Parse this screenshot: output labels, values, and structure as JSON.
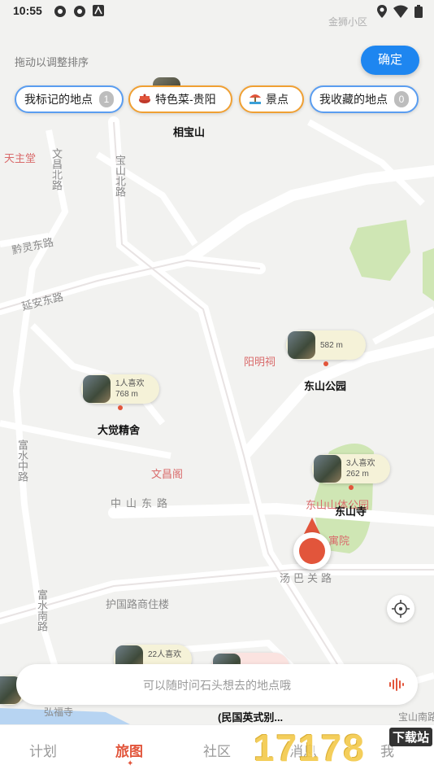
{
  "status_bar": {
    "time": "10:55"
  },
  "header": {
    "hint": "拖动以调整排序",
    "confirm_label": "确定"
  },
  "chips": [
    {
      "label": "我标记的地点",
      "count": "1"
    },
    {
      "label": "特色菜-贵阳",
      "icon": "dish-icon"
    },
    {
      "label": "景点",
      "icon": "attraction-icon"
    },
    {
      "label": "我收藏的地点",
      "count": "0"
    }
  ],
  "markers": {
    "dongshan_park": {
      "distance": "582 m",
      "name": "东山公园"
    },
    "dajue": {
      "likes": "1人喜欢",
      "distance": "768 m",
      "name": "大觉精舍"
    },
    "dongshan_temple": {
      "likes": "3人喜欢",
      "distance": "262 m",
      "name": "东山寺"
    },
    "bottom_left": {
      "likes": "22人喜欢"
    },
    "bottom_mid": {
      "name": "(民国英式别..."
    },
    "top": {
      "name": "相宝山"
    }
  },
  "map_labels": {
    "tianzhutang": "天主堂",
    "baoshan_north": "宝山北路",
    "yangming": "阳明祠",
    "qianling_east": "黔灵东路",
    "yan_an_east": "延安东路",
    "wenchang_pavilion": "文昌阁",
    "zhongshan_east": "中山东路",
    "tangba": "汤巴关路",
    "huguo": "护国路商住楼",
    "dongshan_sports_park": "东山山体公园",
    "fushui_south": "富水南路",
    "fushui_middle": "富水中路",
    "hongfu": "弘福寺",
    "top_district": "金狮小区",
    "wenchang_north": "文昌北路",
    "baoshan_south": "宝山南路",
    "yuyuan": "寓院"
  },
  "search": {
    "placeholder": "可以随时问石头想去的地点哦"
  },
  "nav": {
    "tabs": [
      "计划",
      "旅图",
      "社区",
      "消息",
      "我"
    ],
    "active_index": 1
  },
  "watermark": {
    "text": "17178",
    "sub": "下载站"
  },
  "colors": {
    "accent_blue": "#1e86f0",
    "accent_red": "#e2553b",
    "marker_bg": "#f5f2d8"
  }
}
